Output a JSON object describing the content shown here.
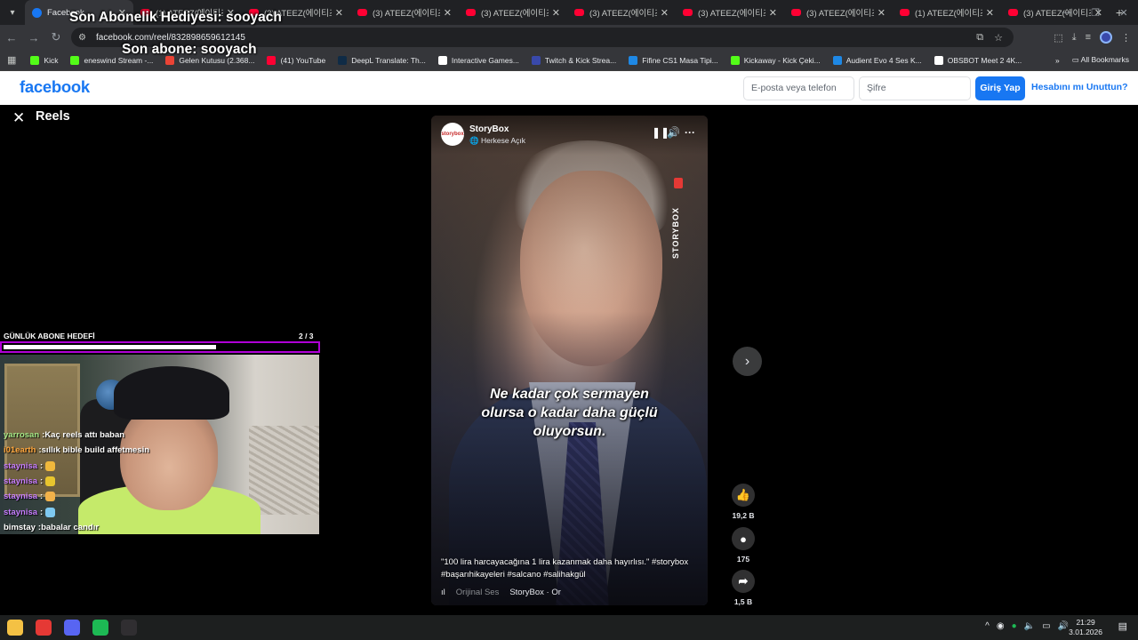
{
  "browser": {
    "tabs": [
      {
        "title": "Facebook",
        "favicon": "facebook-icon",
        "active": true
      },
      {
        "title": "(1) ATEEZ(에이티즈)",
        "favicon": "youtube-icon"
      },
      {
        "title": "(3) ATEEZ(에이티즈)",
        "favicon": "youtube-icon"
      },
      {
        "title": "(3) ATEEZ(에이티즈)",
        "favicon": "youtube-icon"
      },
      {
        "title": "(3) ATEEZ(에이티즈)",
        "favicon": "youtube-icon"
      },
      {
        "title": "(3) ATEEZ(에이티즈)",
        "favicon": "youtube-icon"
      },
      {
        "title": "(3) ATEEZ(에이티즈)",
        "favicon": "youtube-icon"
      },
      {
        "title": "(3) ATEEZ(에이티즈)",
        "favicon": "youtube-icon"
      },
      {
        "title": "(1) ATEEZ(에이티즈)",
        "favicon": "youtube-icon"
      },
      {
        "title": "(3) ATEEZ(에이티즈)",
        "favicon": "youtube-icon"
      }
    ],
    "url": "facebook.com/reel/832898659612145",
    "bookmarks": [
      {
        "label": "Kick",
        "icon": "kick-icon",
        "color": "#53fc18"
      },
      {
        "label": "eneswind Stream -...",
        "icon": "kick-icon",
        "color": "#53fc18"
      },
      {
        "label": "Gelen Kutusu (2.368...",
        "icon": "gmail-icon",
        "color": "#ea4335"
      },
      {
        "label": "(41) YouTube",
        "icon": "youtube-icon",
        "color": "#ff0033"
      },
      {
        "label": "DeepL Translate: Th...",
        "icon": "deepl-icon",
        "color": "#0f2b46"
      },
      {
        "label": "Interactive Games...",
        "icon": "page-icon",
        "color": "#ffffff"
      },
      {
        "label": "Twitch & Kick Strea...",
        "icon": "cp-icon",
        "color": "#3949ab"
      },
      {
        "label": "Fifine CS1 Masa Tipi...",
        "icon": "check-icon",
        "color": "#1e88e5"
      },
      {
        "label": "Kickaway - Kick Çeki...",
        "icon": "kickaway-icon",
        "color": "#53fc18"
      },
      {
        "label": "Audient Evo 4 Ses K...",
        "icon": "check-icon",
        "color": "#1e88e5"
      },
      {
        "label": "OBSBOT Meet 2 4K...",
        "icon": "w-icon",
        "color": "#ffffff"
      }
    ],
    "all_bookmarks": "All Bookmarks"
  },
  "facebook": {
    "logo": "facebook",
    "email_placeholder": "E-posta veya telefon",
    "password_placeholder": "Şifre",
    "login_label": "Giriş Yap",
    "forgot_label": "Hesabını mı Unuttun?",
    "brand_color": "#1877f2"
  },
  "reels": {
    "title": "Reels",
    "page_name": "StoryBox",
    "privacy": "Herkese Açık",
    "subtitle_lines": [
      "Ne kadar çok sermayen",
      "olursa o kadar daha güçlü",
      "oluyorsun."
    ],
    "caption_line1": "\"100 lira harcayacağına 1 lira kazanmak daha hayırlısı.\" #storybox",
    "caption_line2": "#başarıhikayeleri #salcano  #salihakgül",
    "audio_label": "Orijinal Ses",
    "audio_owner": "StoryBox · Or",
    "likes": "19,2 B",
    "comments": "175",
    "shares": "1,5 B",
    "brand_tag": "STORYBOX"
  },
  "overlay": {
    "last_gift_sub": "Son Abonelik Hediyesi: sooyach",
    "last_sub": "Son abone: sooyach",
    "goal_label": "GÜNLÜK ABONE HEDEFİ",
    "goal_count": "2  / 3",
    "goal_progress": 0.67,
    "goal_border_color": "#b000d6"
  },
  "chat": [
    {
      "user": "yarrosan",
      "color": "#a5e887",
      "text": "Kaç reels attı baban"
    },
    {
      "user": "i01earth",
      "color": "#ffa63d",
      "text": "sıllık bible build affetmesin"
    },
    {
      "user": "staynisa",
      "color": "#c77dff",
      "text": "",
      "emote": "#f0b83c"
    },
    {
      "user": "staynisa",
      "color": "#c77dff",
      "text": "",
      "emote": "#e8c52e"
    },
    {
      "user": "staynisa",
      "color": "#c77dff",
      "text": "",
      "emote": "#f2b24a"
    },
    {
      "user": "staynisa",
      "color": "#c77dff",
      "text": "",
      "emote": "#7ec8f0"
    },
    {
      "user": "bimstay",
      "color": "#ffffff",
      "text": "babalar candır"
    }
  ],
  "taskbar": {
    "time": "21:29",
    "date": "3.01.2026",
    "apps": [
      {
        "name": "file-explorer-icon",
        "color": "#f4c144"
      },
      {
        "name": "chrome-icon",
        "color": "#e53935"
      },
      {
        "name": "discord-icon",
        "color": "#5865f2"
      },
      {
        "name": "spotify-icon",
        "color": "#1db954"
      },
      {
        "name": "obs-icon",
        "color": "#302e31"
      }
    ]
  }
}
